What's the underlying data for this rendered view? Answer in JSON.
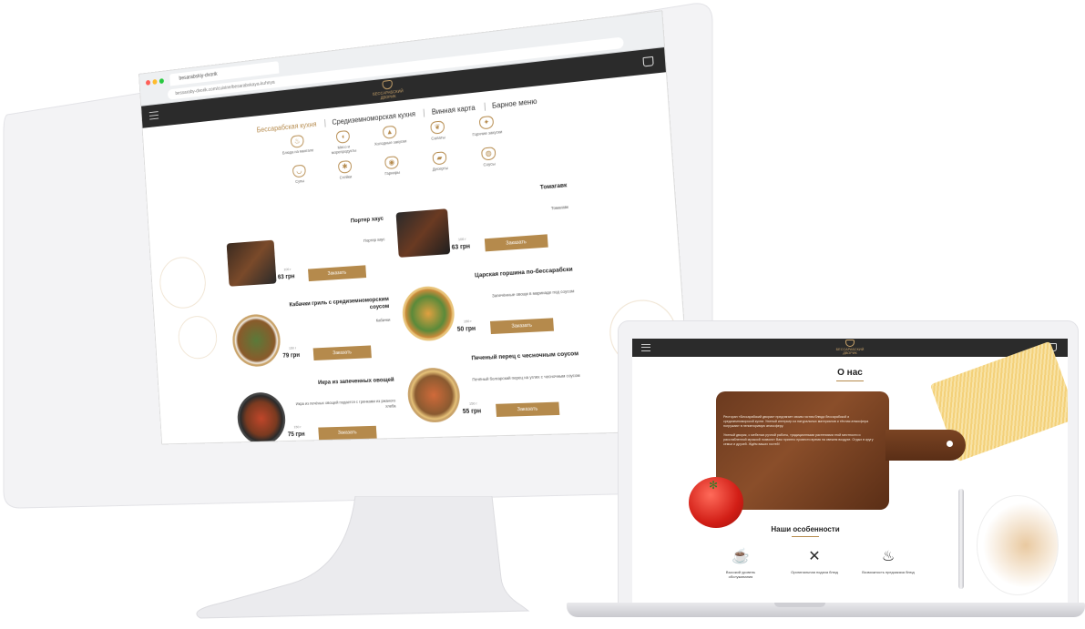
{
  "desktop": {
    "browser": {
      "tab_title": "besarabskiy-dvorik",
      "url": "bessaraby-dvorik.com/cuisine/besarabskaya-kuhnya"
    },
    "header": {
      "logo_text": "БЕССАРАБСКИЙ ДВОРИК"
    },
    "menu_tabs": [
      "Бессарабская кухня",
      "Средиземноморская кухня",
      "Винная карта",
      "Барное меню"
    ],
    "categories": [
      {
        "label": "Блюда на мангале",
        "icon": "grill-icon"
      },
      {
        "label": "Мясо и морепродукты",
        "icon": "meat-icon"
      },
      {
        "label": "Холодные закуски",
        "icon": "cold-snacks-icon"
      },
      {
        "label": "Салаты",
        "icon": "salad-icon"
      },
      {
        "label": "Горячие закуски",
        "icon": "hot-snacks-icon"
      },
      {
        "label": "Супы",
        "icon": "soup-icon"
      },
      {
        "label": "Гарниры",
        "icon": "garnish-icon"
      },
      {
        "label": "Десерты",
        "icon": "dessert-icon"
      },
      {
        "label": "Соусы",
        "icon": "sauce-icon"
      },
      {
        "label": "Стейки",
        "icon": "steak-icon"
      }
    ],
    "dishes": [
      {
        "name": "Портер хаус",
        "desc": "Портер хаус",
        "weight": "100 г",
        "price": "63 грн",
        "order_label": "Заказать"
      },
      {
        "name": "Томагавк",
        "desc": "Томагавк",
        "weight": "100 г",
        "price": "63 грн",
        "order_label": "Заказать"
      },
      {
        "name": "Кабачки гриль с средиземноморским соусом",
        "desc": "Кабачки",
        "weight": "150 г",
        "price": "79 грн",
        "order_label": "Заказать"
      },
      {
        "name": "Царская горшина по-бессарабски",
        "desc": "Запечённые овощи в маринаде под соусом",
        "weight": "150 г",
        "price": "50 грн",
        "order_label": "Заказать"
      },
      {
        "name": "Икра из запеченных овощей",
        "desc": "Икра из печёных овощей подается с гренками из ржаного хлеба",
        "weight": "150 г",
        "price": "75 грн",
        "order_label": "Заказать"
      },
      {
        "name": "Печеный перец с чесночным соусом",
        "desc": "Печёный болгарский перец на углях с чесночным соусом",
        "weight": "150 г",
        "price": "55 грн",
        "order_label": "Заказать"
      }
    ]
  },
  "laptop": {
    "header": {
      "logo_text": "БЕССАРАБСКИЙ ДВОРИК"
    },
    "about_title": "О нас",
    "about_paragraphs": [
      "Ресторан «Бессарабский дворик» предлагает своим гостям блюда бессарабской и средиземноморской кухни. Уютный интерьер из натуральных материалов и тёплая атмосфера погружают в неповторимую атмосферу.",
      "Уютный дворик, с мебелью ручной работы, традиционными растениями этой местности и расслабленной музыкой позволит Вам приятно провести время на свежем воздухе. Отдых в кругу семьи и друзей. Ждём ваших гостей!"
    ],
    "features_title": "Наши особенности",
    "features": [
      {
        "label": "Высокий уровень обслуживания",
        "icon": "service-icon"
      },
      {
        "label": "Оригинальная подача блюд",
        "icon": "cutlery-icon"
      },
      {
        "label": "Возможность предзаказа блюд",
        "icon": "coffee-cup-icon"
      }
    ]
  },
  "colors": {
    "accent": "#b58a4c",
    "header_bg": "#2b2b2b",
    "board_wood": "#6b3a1f"
  }
}
